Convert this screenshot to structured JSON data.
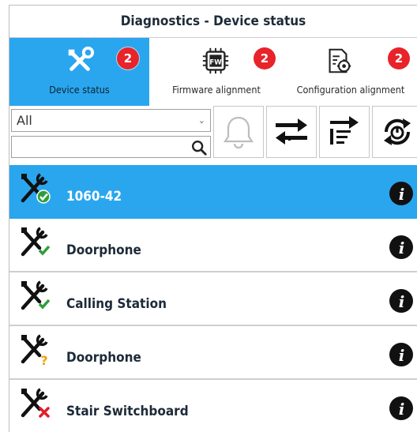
{
  "window": {
    "title": "Diagnostics - Device status"
  },
  "tabs": [
    {
      "label": "Device status",
      "badge": "2",
      "icon": "tools-icon",
      "active": true
    },
    {
      "label": "Firmware alignment",
      "badge": "2",
      "icon": "firmware-chip-icon",
      "active": false
    },
    {
      "label": "Configuration alignment",
      "badge": "2",
      "icon": "config-document-gear-icon",
      "active": false
    }
  ],
  "filter": {
    "selected": "All",
    "search_value": ""
  },
  "toolbar": {
    "buttons": [
      "bell-icon",
      "transfer-arrows-icon",
      "list-send-icon",
      "power-refresh-icon"
    ]
  },
  "devices": [
    {
      "name": "1060-42",
      "status": "ok",
      "selected": true
    },
    {
      "name": "Doorphone",
      "status": "ok",
      "selected": false
    },
    {
      "name": "Calling Station",
      "status": "ok",
      "selected": false
    },
    {
      "name": "Doorphone",
      "status": "unknown",
      "selected": false
    },
    {
      "name": "Stair Switchboard",
      "status": "error",
      "selected": false
    }
  ],
  "colors": {
    "accent": "#2aa6ef",
    "badge": "#e8232a",
    "ok": "#2e9e3a",
    "warning": "#f0a100",
    "error": "#e0202a"
  }
}
